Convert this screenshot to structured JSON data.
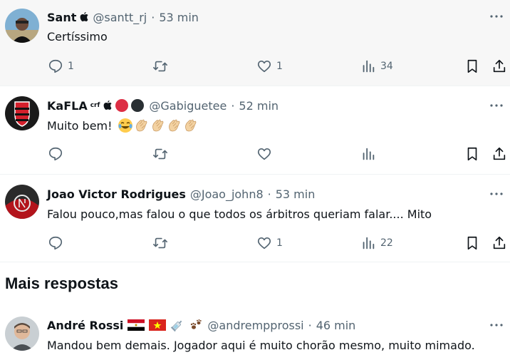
{
  "colors": {
    "text": "#0f1419",
    "secondary": "#536471",
    "divider": "#eff3f4",
    "hover_bg": "#f7f7f7",
    "flamengo_red": "#d4202c",
    "flamengo_black": "#1a1a1a"
  },
  "tweets": [
    {
      "name": "Sant",
      "handle": "@santt_rj",
      "time": "53 min",
      "text": "Certíssimo",
      "replies": "1",
      "likes": "1",
      "views": "34",
      "badges": [
        "apple-icon"
      ]
    },
    {
      "name": "KaFLA",
      "superscript": "crf",
      "handle": "@Gabiguetee",
      "time": "52 min",
      "text": "Muito bem! ",
      "emojis": [
        "tears-of-joy-emoji",
        "clapping-hands-emoji",
        "clapping-hands-emoji",
        "clapping-hands-emoji",
        "clapping-hands-emoji"
      ],
      "replies": "",
      "likes": "",
      "views": "",
      "badges": [
        "apple-icon",
        "red-circle-icon",
        "black-circle-icon"
      ]
    },
    {
      "name": "Joao Victor Rodrigues",
      "handle": "@Joao_john8",
      "time": "53 min",
      "text": "Falou pouco,mas falou o que todos os árbitros queriam falar.... Mito",
      "replies": "",
      "likes": "1",
      "views": "22"
    },
    {
      "name": "André Rossi",
      "handle": "@andrempprossi",
      "time": "46 min",
      "text": "Mandou bem demais. Jogador aqui é muito chorão mesmo, muito mimado.",
      "badges": [
        "egypt-flag-icon",
        "vietnam-flag-icon",
        "syringe-icon",
        "paw-prints-icon"
      ]
    }
  ],
  "section": {
    "title": "Mais respostas"
  }
}
